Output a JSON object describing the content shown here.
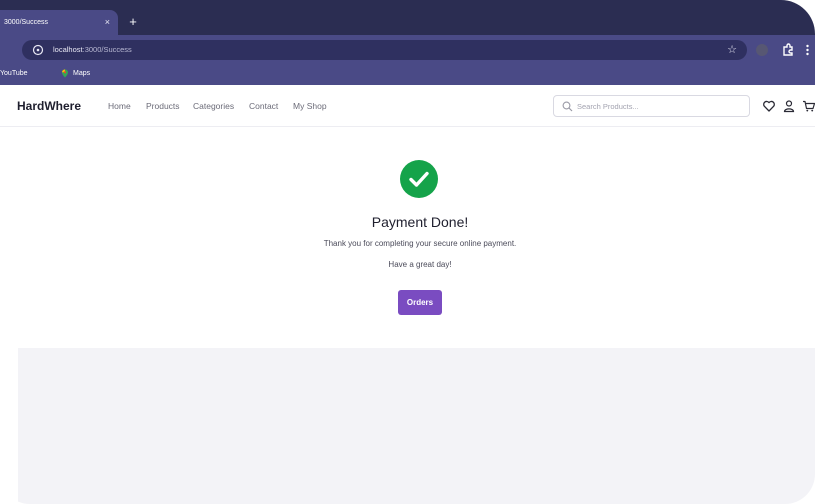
{
  "browser": {
    "tab_title": "3000/Success",
    "tab_close": "×",
    "new_tab": "+",
    "url_host": "localhost",
    "url_path": ":3000/Success",
    "bookmarks": [
      {
        "label": "YouTube"
      },
      {
        "label": "Maps"
      }
    ]
  },
  "site": {
    "logo": "HardWhere",
    "nav": [
      "Home",
      "Products",
      "Categories",
      "Contact",
      "My Shop"
    ],
    "search_placeholder": "Search Products..."
  },
  "success": {
    "title": "Payment Done!",
    "message": "Thank you for completing your secure online payment.",
    "message2": "Have a great day!",
    "orders_button": "Orders"
  },
  "colors": {
    "tabstrip": "#2b2d52",
    "toolbar": "#4a4a86",
    "success_green": "#15a34a",
    "button_purple": "#7a4cc1",
    "footer_gray": "#f3f3f7"
  },
  "icons": [
    "info-icon",
    "star-icon",
    "extensions-icon",
    "more-icon",
    "maps-icon",
    "search-icon",
    "heart-icon",
    "user-icon",
    "cart-icon",
    "check-icon"
  ]
}
